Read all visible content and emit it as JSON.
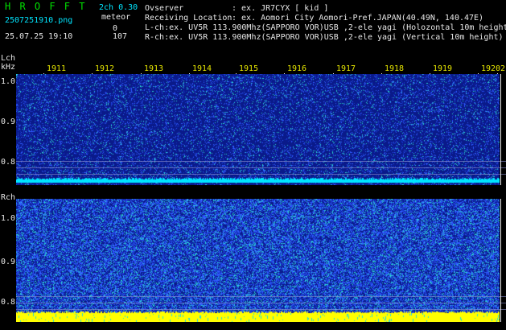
{
  "header": {
    "brand": "H R O F F T",
    "filename": "2507251910.png",
    "datetime": "25.07.25 19:10",
    "mode": "2ch 0.30",
    "meteor_label": "meteor",
    "lch_count": "0",
    "rch_count": "107",
    "observer_label": "Ovserver",
    "observer_value": ": ex. JR7CYX [ kid ]",
    "location_label": "Receiving Location",
    "location_value": ": ex. Aomori City Aomori-Pref.JAPAN(40.49N, 140.47E)",
    "lch_info": "L-ch:ex. UV5R 113.900Mhz(SAPPORO VOR)USB ,2-ele yagi (Holozontal 10m height)",
    "rch_info": "R-ch:ex. UV5R 113.900Mhz(SAPPORO VOR)USB ,2-ele yagi (Vertical 10m height)"
  },
  "time_axis": {
    "ticks": [
      "1911",
      "1912",
      "1913",
      "1914",
      "1915",
      "1916",
      "1917",
      "1918",
      "1919",
      "1920",
      "2"
    ]
  },
  "lch_panel": {
    "label": "Lch",
    "unit": "kHz",
    "y_ticks": [
      "1.0",
      "0.9",
      "0.8"
    ]
  },
  "rch_panel": {
    "label": "Rch",
    "y_ticks": [
      "1.0",
      "0.9",
      "0.8"
    ]
  },
  "colors": {
    "background": "#000000",
    "panel_base": "#0a1a8a",
    "noise_light": "#2f5bff",
    "noise_cyan": "#2ad9d0",
    "tone_cyan": "#00e5ff",
    "tone_yellow": "#ffff00",
    "brand_green": "#00e000",
    "tick_yellow": "#e6e600"
  }
}
